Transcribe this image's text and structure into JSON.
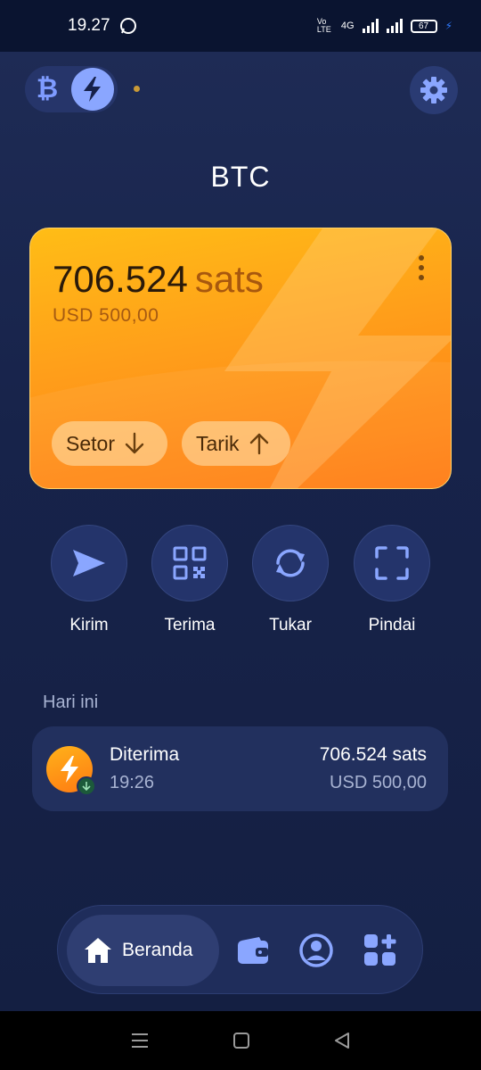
{
  "status_bar": {
    "time": "19.27",
    "volte": "Vo LTE",
    "network": "4G",
    "battery": "67"
  },
  "header": {
    "title": "BTC"
  },
  "card": {
    "balance_value": "706.524",
    "balance_unit": "sats",
    "balance_usd": "USD 500,00",
    "deposit_label": "Setor",
    "withdraw_label": "Tarik"
  },
  "actions": [
    {
      "label": "Kirim",
      "icon": "send-icon"
    },
    {
      "label": "Terima",
      "icon": "qr-code-icon"
    },
    {
      "label": "Tukar",
      "icon": "swap-icon"
    },
    {
      "label": "Pindai",
      "icon": "scan-icon"
    }
  ],
  "transactions": {
    "section_label": "Hari ini",
    "items": [
      {
        "title": "Diterima",
        "time": "19:26",
        "amount": "706.524 sats",
        "amount_usd": "USD 500,00"
      }
    ]
  },
  "bottom_nav": {
    "home_label": "Beranda",
    "items": [
      "home-icon",
      "wallet-icon",
      "profile-icon",
      "apps-icon"
    ]
  },
  "colors": {
    "background": "#172347",
    "card_start": "#ffbd16",
    "card_end": "#ff7a12",
    "accent": "#8aa6ff"
  }
}
